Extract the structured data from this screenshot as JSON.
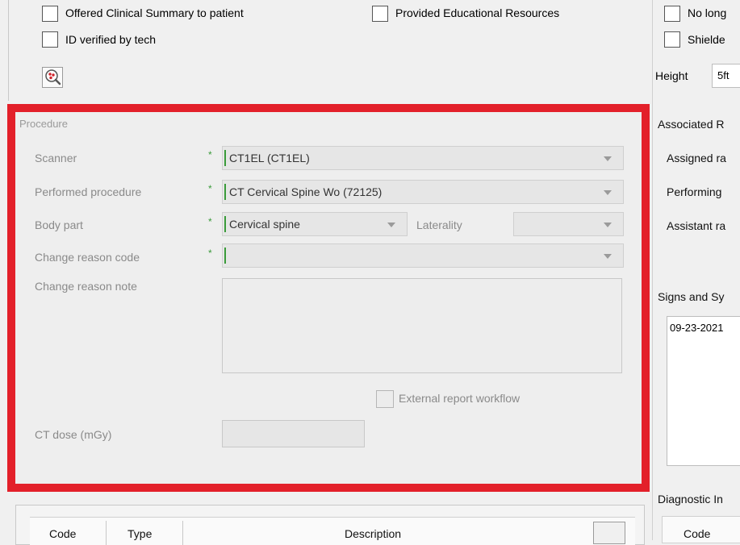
{
  "top_checkboxes": {
    "offered_summary": "Offered Clinical Summary to patient",
    "id_verified": "ID verified by tech",
    "educational": "Provided Educational Resources",
    "no_longer": "No long",
    "shielded": "Shielde"
  },
  "height": {
    "label": "Height",
    "value": "5ft"
  },
  "procedure": {
    "section_title": "Procedure",
    "scanner_label": "Scanner",
    "scanner_value": "CT1EL (CT1EL)",
    "performed_label": "Performed procedure",
    "performed_value": "CT Cervical Spine Wo (72125)",
    "body_part_label": "Body part",
    "body_part_value": "Cervical spine",
    "laterality_label": "Laterality",
    "laterality_value": "",
    "change_code_label": "Change reason code",
    "change_code_value": "",
    "change_note_label": "Change reason note",
    "external_label": "External report workflow",
    "ct_dose_label": "CT dose (mGy)",
    "required_marker": "*"
  },
  "right_panel": {
    "assoc_title": "Associated R",
    "assigned": "Assigned ra",
    "performing": "Performing",
    "assistant": "Assistant ra",
    "signs_title": "Signs and Sy",
    "signs_date": "09-23-2021",
    "diagnostic_title": "Diagnostic In",
    "code_header": "Code"
  },
  "bottom_table": {
    "headers": [
      "Code",
      "Type",
      "Description"
    ]
  },
  "colors": {
    "highlight": "#e3202a",
    "required": "#3a9b3a"
  }
}
